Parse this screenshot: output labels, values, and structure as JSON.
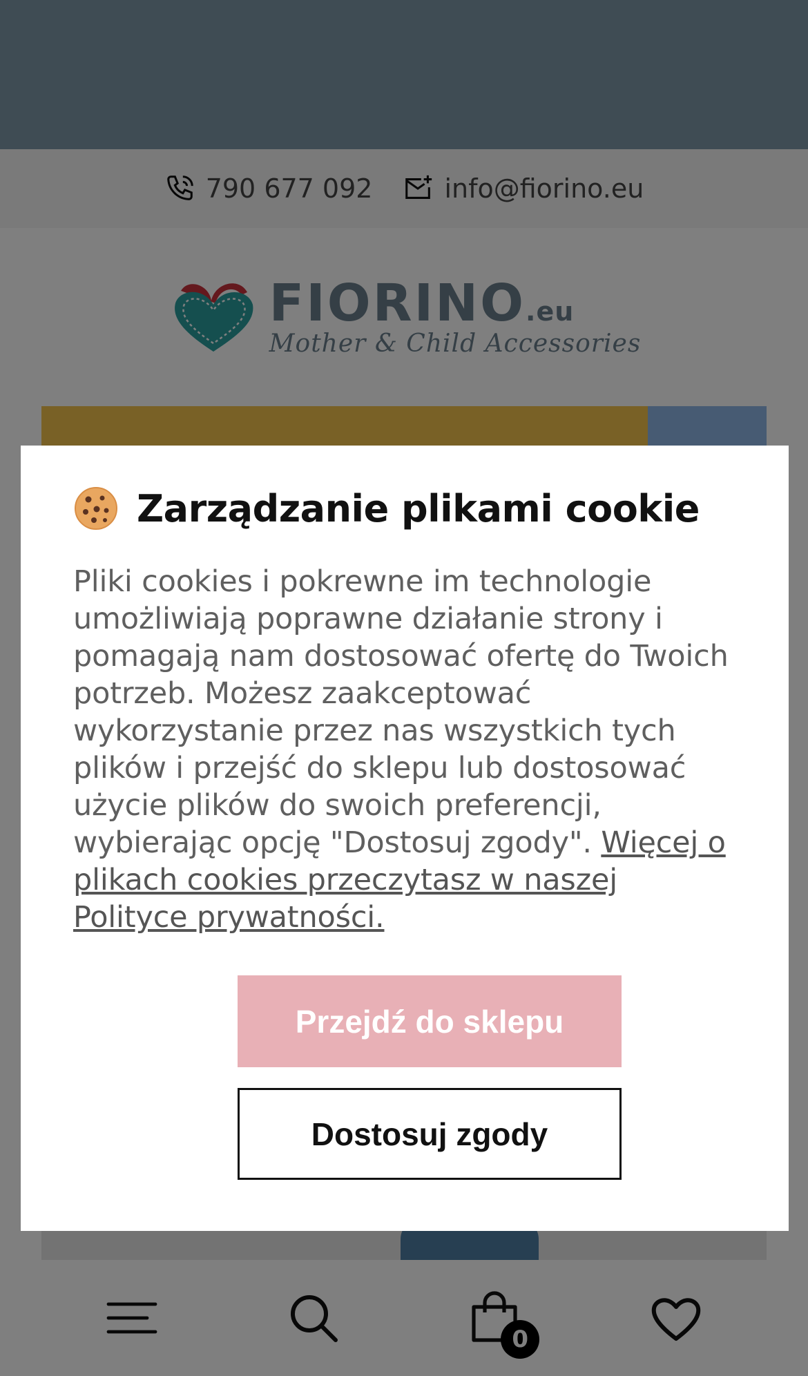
{
  "contact": {
    "phone": "790 677 092",
    "email": "info@fiorino.eu"
  },
  "logo": {
    "brand": "FIORINO",
    "tld": ".eu",
    "tagline": "Mother & Child Accessories"
  },
  "bottom_nav": {
    "cart_count": "0"
  },
  "cookie_modal": {
    "title": "Zarządzanie plikami cookie",
    "body": "Pliki cookies i pokrewne im technologie umożliwiają poprawne działanie strony i pomagają nam dostosować ofertę do Twoich potrzeb. Możesz zaakceptować wykorzystanie przez nas wszystkich tych plików i przejść do sklepu lub dostosować użycie plików do swoich preferencji, wybierając opcję \"Dostosuj zgody\". ",
    "link_text": "Więcej o plikach cookies przeczytasz w naszej Polityce prywatności.",
    "accept_button": "Przejdź do sklepu",
    "customize_button": "Dostosuj zgody"
  },
  "colors": {
    "accept_button_bg": "#e8b0b6",
    "banner_bg": "#7f98a8",
    "logo_teal": "#2a9e9e",
    "logo_red": "#c8323c"
  }
}
